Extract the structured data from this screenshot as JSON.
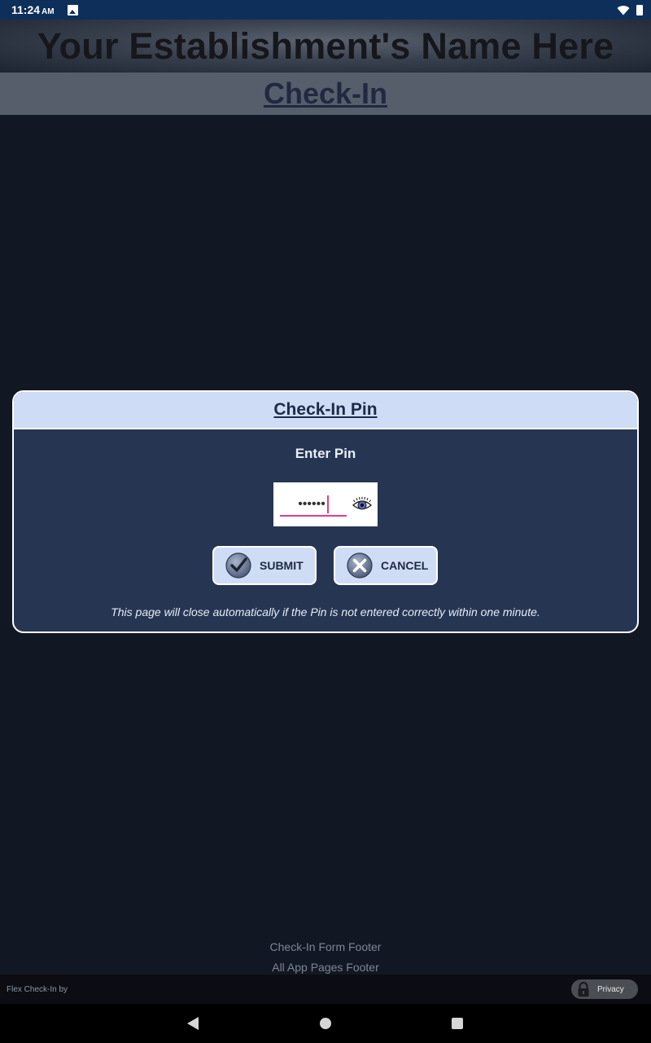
{
  "status_bar": {
    "time": "11:24",
    "ampm": "AM"
  },
  "header": {
    "title": "Your Establishment's Name Here",
    "subtitle": "Check-In"
  },
  "dialog": {
    "title": "Check-In Pin",
    "prompt": "Enter Pin",
    "pin_value": "••••••",
    "submit_label": "SUBMIT",
    "cancel_label": "CANCEL",
    "notice": "This page will close automatically if the Pin is not entered correctly within one minute."
  },
  "footer": {
    "form_footer": "Check-In Form Footer",
    "app_footer": "All App Pages Footer",
    "brand": "Flex Check-In by",
    "privacy_label": "Privacy"
  },
  "colors": {
    "background": "#121724",
    "dialog_body": "#263552",
    "dialog_header": "#cfdcf5",
    "input_underline": "#e63c8a"
  },
  "icons": {
    "eye": "eye-icon",
    "submit": "checkmark-circle-icon",
    "cancel": "x-circle-icon",
    "privacy": "lock-icon"
  }
}
